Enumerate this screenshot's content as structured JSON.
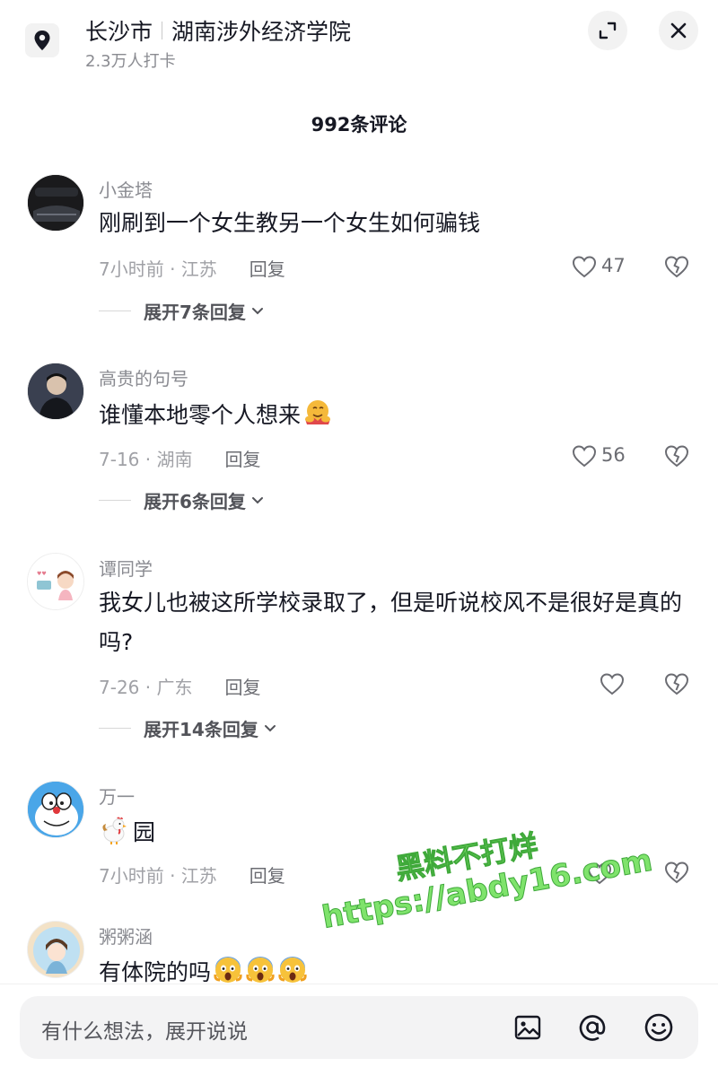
{
  "header": {
    "city": "长沙市",
    "place": "湖南涉外经济学院",
    "checkins": "2.3万人打卡"
  },
  "comment_count": "992条评论",
  "comments": [
    {
      "name": "小金塔",
      "text": "刚刷到一个女生教另一个女生如何骗钱",
      "time_loc": "7小时前 · 江苏",
      "reply": "回复",
      "likes": "47",
      "expand": "展开7条回复"
    },
    {
      "name": "高贵的句号",
      "text": "谁懂本地零个人想来",
      "emoji": "hug-face-emoji",
      "time_loc": "7-16 · 湖南",
      "reply": "回复",
      "likes": "56",
      "expand": "展开6条回复"
    },
    {
      "name": "谭同学",
      "text": "我女儿也被这所学校录取了，但是听说校风不是很好是真的吗?",
      "time_loc": "7-26 · 广东",
      "reply": "回复",
      "likes": "",
      "expand": "展开14条回复"
    },
    {
      "name": "万一",
      "text": "园",
      "emoji": "rooster-emoji",
      "time_loc": "7小时前 · 江苏",
      "reply": "回复",
      "likes": ""
    },
    {
      "name": "粥粥涵",
      "text": "有体院的吗",
      "emoji": "screaming-face-emoji"
    }
  ],
  "watermark": {
    "line1": "黑料不打烊",
    "line2": "https://abdy16.com"
  },
  "input": {
    "placeholder": "有什么想法，展开说说"
  },
  "colors": {
    "text": "#161823",
    "secondary": "#8a8b91",
    "watermark": "#7fe36c"
  }
}
